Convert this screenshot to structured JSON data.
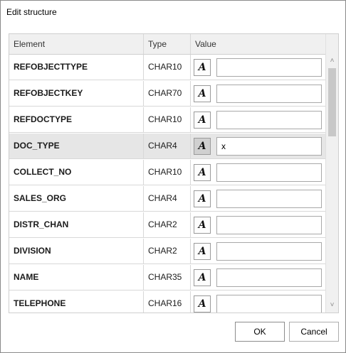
{
  "dialog": {
    "title": "Edit structure"
  },
  "table": {
    "columns": [
      "Element",
      "Type",
      "Value"
    ],
    "rows": [
      {
        "element": "REFOBJECTTYPE",
        "type": "CHAR10",
        "value": "",
        "selected": false
      },
      {
        "element": "REFOBJECTKEY",
        "type": "CHAR70",
        "value": "",
        "selected": false
      },
      {
        "element": "REFDOCTYPE",
        "type": "CHAR10",
        "value": "",
        "selected": false
      },
      {
        "element": "DOC_TYPE",
        "type": "CHAR4",
        "value": "x",
        "selected": true
      },
      {
        "element": "COLLECT_NO",
        "type": "CHAR10",
        "value": "",
        "selected": false
      },
      {
        "element": "SALES_ORG",
        "type": "CHAR4",
        "value": "",
        "selected": false
      },
      {
        "element": "DISTR_CHAN",
        "type": "CHAR2",
        "value": "",
        "selected": false
      },
      {
        "element": "DIVISION",
        "type": "CHAR2",
        "value": "",
        "selected": false
      },
      {
        "element": "NAME",
        "type": "CHAR35",
        "value": "",
        "selected": false
      },
      {
        "element": "TELEPHONE",
        "type": "CHAR16",
        "value": "",
        "selected": false
      }
    ],
    "value_button_icon": "text-format-icon",
    "value_button_glyph": "A"
  },
  "scrollbar": {
    "up_glyph": "˄",
    "down_glyph": "˅"
  },
  "buttons": {
    "ok": "OK",
    "cancel": "Cancel"
  }
}
